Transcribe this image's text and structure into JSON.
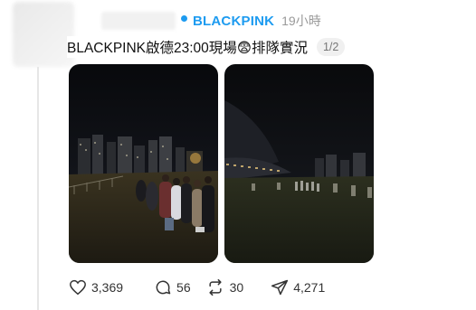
{
  "post": {
    "username": "BLACKPINK",
    "time": "19小時",
    "text": "BLACKPINK啟德23:00現場😨排隊實況",
    "pager": "1/2"
  },
  "photos": [
    {
      "icon": "photo-night-queue-city"
    },
    {
      "icon": "photo-night-stadium-field"
    }
  ],
  "actions": {
    "like_count": "3,369",
    "reply_count": "56",
    "repost_count": "30",
    "share_count": "4,271"
  },
  "colors": {
    "accent": "#1d9bf0",
    "pager_bg": "#f0f0f0"
  }
}
